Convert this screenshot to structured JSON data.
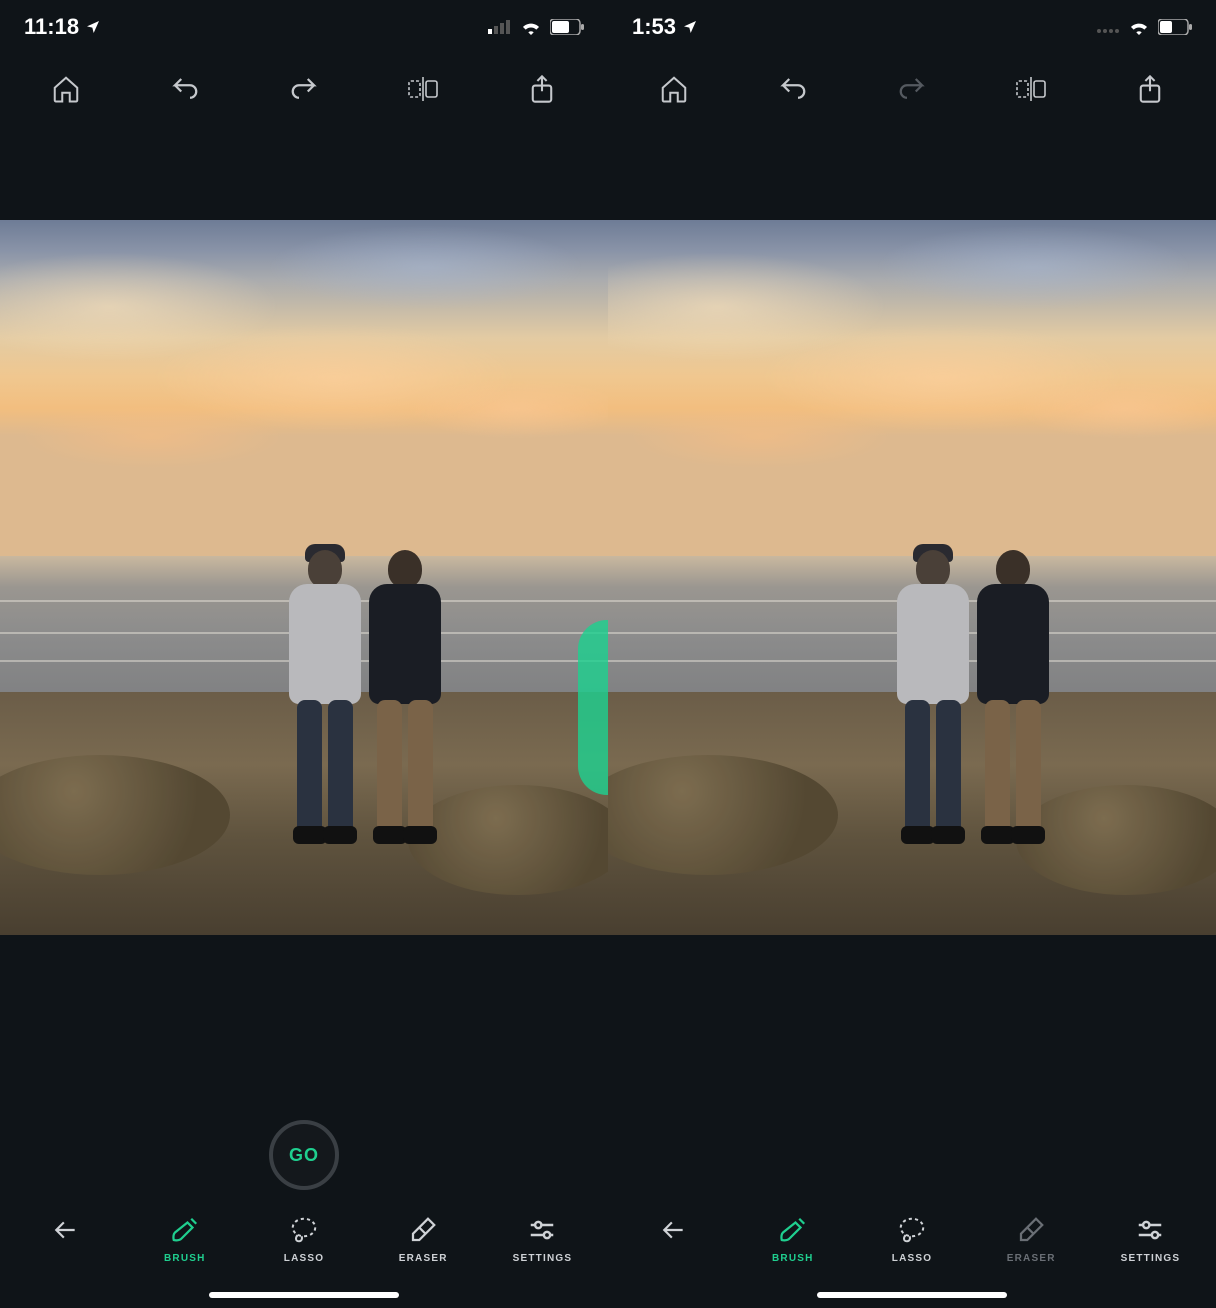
{
  "screens": [
    {
      "status": {
        "time": "11:18",
        "cellular_bars": 1,
        "wifi": true,
        "battery_pct": 60
      },
      "top_toolbar": {
        "home": true,
        "undo": true,
        "redo": {
          "enabled": true
        },
        "compare": true,
        "share": true
      },
      "photo": {
        "description": "Two people standing on coastal rocks at sunset; ocean and cloudy golden sky behind.",
        "brush_mark": {
          "visible": true,
          "color": "#1fcf8f"
        }
      },
      "action": {
        "go": "GO",
        "visible": true
      },
      "tools": {
        "back": true,
        "items": [
          {
            "key": "brush",
            "label": "BRUSH",
            "active": true
          },
          {
            "key": "lasso",
            "label": "LASSO",
            "active": false
          },
          {
            "key": "eraser",
            "label": "ERASER",
            "active": false
          },
          {
            "key": "settings",
            "label": "SETTINGS",
            "active": false
          }
        ]
      }
    },
    {
      "status": {
        "time": "1:53",
        "cellular_bars": 0,
        "wifi": true,
        "battery_pct": 45
      },
      "top_toolbar": {
        "home": true,
        "undo": true,
        "redo": {
          "enabled": false
        },
        "compare": true,
        "share": true
      },
      "photo": {
        "description": "Same photo after object removal; no brush mark, no extra figure on the right.",
        "brush_mark": {
          "visible": false
        }
      },
      "action": {
        "go": "GO",
        "visible": false
      },
      "tools": {
        "back": true,
        "items": [
          {
            "key": "brush",
            "label": "BRUSH",
            "active": true
          },
          {
            "key": "lasso",
            "label": "LASSO",
            "active": false
          },
          {
            "key": "eraser",
            "label": "ERASER",
            "active": false,
            "dim": true
          },
          {
            "key": "settings",
            "label": "SETTINGS",
            "active": false
          }
        ]
      }
    }
  ],
  "colors": {
    "accent": "#1fcf8f",
    "bg": "#0f1418"
  }
}
